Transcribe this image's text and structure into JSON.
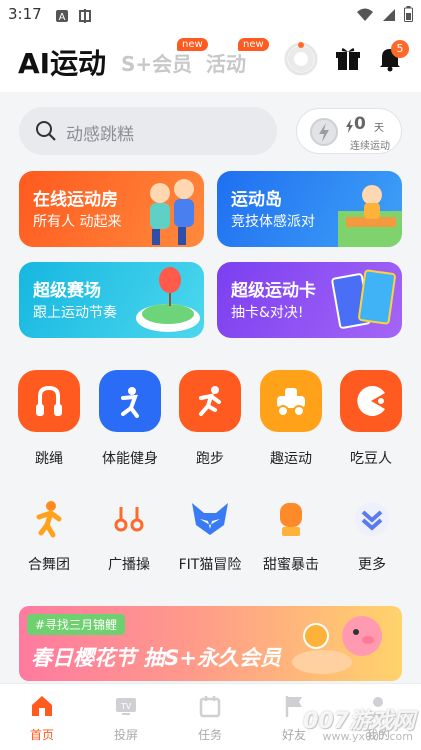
{
  "status_bar": {
    "time": "3:17",
    "icons": [
      "a-box-icon",
      "app-icon",
      "wifi-icon",
      "signal-icon",
      "battery-icon"
    ]
  },
  "header": {
    "title": "AI运动",
    "tabs": [
      {
        "label": "S+会员",
        "badge": "new"
      },
      {
        "label": "活动",
        "badge": "new"
      }
    ],
    "notification_count": "5"
  },
  "search": {
    "placeholder": "动感跳糕"
  },
  "streak": {
    "days": "0",
    "unit": "天",
    "label": "连续运动"
  },
  "banners": [
    {
      "title": "在线运动房",
      "subtitle": "所有人 动起来",
      "color": "#ff6b2c"
    },
    {
      "title": "运动岛",
      "subtitle": "竞技体感派对",
      "color": "#2f86f0"
    },
    {
      "title": "超级赛场",
      "subtitle": "跟上运动节奏",
      "color": "#21bfe0"
    },
    {
      "title": "超级运动卡",
      "subtitle": "抽卡&对决!",
      "color": "#8a55f2"
    }
  ],
  "grid_primary": [
    {
      "label": "跳绳",
      "icon": "jump-rope-icon"
    },
    {
      "label": "体能健身",
      "icon": "fitness-icon"
    },
    {
      "label": "跑步",
      "icon": "running-icon"
    },
    {
      "label": "趣运动",
      "icon": "fun-sport-icon"
    },
    {
      "label": "吃豆人",
      "icon": "pacman-icon"
    }
  ],
  "grid_secondary": [
    {
      "label": "合舞团",
      "icon": "dance-icon"
    },
    {
      "label": "广播操",
      "icon": "radio-exercise-icon"
    },
    {
      "label": "FIT猫冒险",
      "icon": "fit-cat-icon"
    },
    {
      "label": "甜蜜暴击",
      "icon": "boxing-glove-icon"
    },
    {
      "label": "更多",
      "icon": "more-chevron-icon"
    }
  ],
  "promo": {
    "tag": "#寻找三月锦鲤",
    "headline": "春日樱花节  抽S+永久会员"
  },
  "bottom_nav": [
    {
      "label": "首页",
      "active": true
    },
    {
      "label": "投屏",
      "active": false
    },
    {
      "label": "任务",
      "active": false
    },
    {
      "label": "好友",
      "active": false
    },
    {
      "label": "我的",
      "active": false
    }
  ],
  "watermark": {
    "text": "007游戏网",
    "url_text": "www.yx007.com"
  }
}
